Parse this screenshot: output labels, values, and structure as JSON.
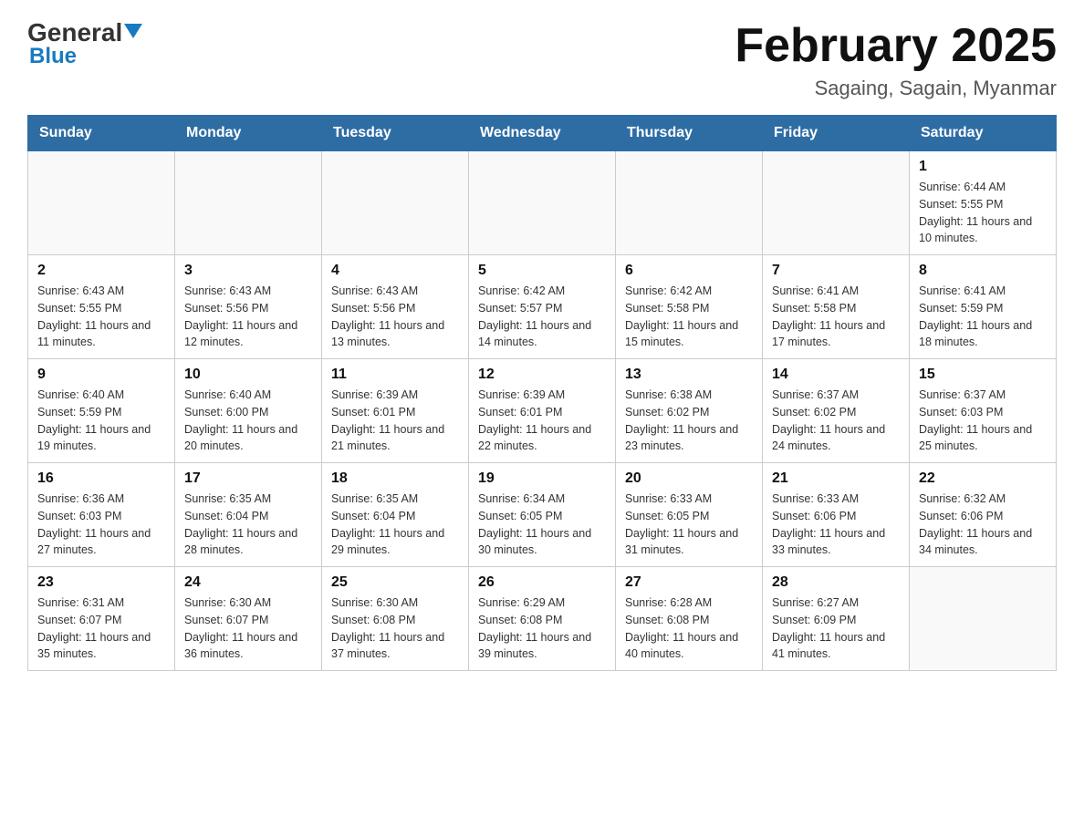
{
  "header": {
    "logo_general": "General",
    "logo_blue": "Blue",
    "month_title": "February 2025",
    "subtitle": "Sagaing, Sagain, Myanmar"
  },
  "days_of_week": [
    "Sunday",
    "Monday",
    "Tuesday",
    "Wednesday",
    "Thursday",
    "Friday",
    "Saturday"
  ],
  "weeks": [
    [
      null,
      null,
      null,
      null,
      null,
      null,
      {
        "day": "1",
        "sunrise": "Sunrise: 6:44 AM",
        "sunset": "Sunset: 5:55 PM",
        "daylight": "Daylight: 11 hours and 10 minutes."
      }
    ],
    [
      {
        "day": "2",
        "sunrise": "Sunrise: 6:43 AM",
        "sunset": "Sunset: 5:55 PM",
        "daylight": "Daylight: 11 hours and 11 minutes."
      },
      {
        "day": "3",
        "sunrise": "Sunrise: 6:43 AM",
        "sunset": "Sunset: 5:56 PM",
        "daylight": "Daylight: 11 hours and 12 minutes."
      },
      {
        "day": "4",
        "sunrise": "Sunrise: 6:43 AM",
        "sunset": "Sunset: 5:56 PM",
        "daylight": "Daylight: 11 hours and 13 minutes."
      },
      {
        "day": "5",
        "sunrise": "Sunrise: 6:42 AM",
        "sunset": "Sunset: 5:57 PM",
        "daylight": "Daylight: 11 hours and 14 minutes."
      },
      {
        "day": "6",
        "sunrise": "Sunrise: 6:42 AM",
        "sunset": "Sunset: 5:58 PM",
        "daylight": "Daylight: 11 hours and 15 minutes."
      },
      {
        "day": "7",
        "sunrise": "Sunrise: 6:41 AM",
        "sunset": "Sunset: 5:58 PM",
        "daylight": "Daylight: 11 hours and 17 minutes."
      },
      {
        "day": "8",
        "sunrise": "Sunrise: 6:41 AM",
        "sunset": "Sunset: 5:59 PM",
        "daylight": "Daylight: 11 hours and 18 minutes."
      }
    ],
    [
      {
        "day": "9",
        "sunrise": "Sunrise: 6:40 AM",
        "sunset": "Sunset: 5:59 PM",
        "daylight": "Daylight: 11 hours and 19 minutes."
      },
      {
        "day": "10",
        "sunrise": "Sunrise: 6:40 AM",
        "sunset": "Sunset: 6:00 PM",
        "daylight": "Daylight: 11 hours and 20 minutes."
      },
      {
        "day": "11",
        "sunrise": "Sunrise: 6:39 AM",
        "sunset": "Sunset: 6:01 PM",
        "daylight": "Daylight: 11 hours and 21 minutes."
      },
      {
        "day": "12",
        "sunrise": "Sunrise: 6:39 AM",
        "sunset": "Sunset: 6:01 PM",
        "daylight": "Daylight: 11 hours and 22 minutes."
      },
      {
        "day": "13",
        "sunrise": "Sunrise: 6:38 AM",
        "sunset": "Sunset: 6:02 PM",
        "daylight": "Daylight: 11 hours and 23 minutes."
      },
      {
        "day": "14",
        "sunrise": "Sunrise: 6:37 AM",
        "sunset": "Sunset: 6:02 PM",
        "daylight": "Daylight: 11 hours and 24 minutes."
      },
      {
        "day": "15",
        "sunrise": "Sunrise: 6:37 AM",
        "sunset": "Sunset: 6:03 PM",
        "daylight": "Daylight: 11 hours and 25 minutes."
      }
    ],
    [
      {
        "day": "16",
        "sunrise": "Sunrise: 6:36 AM",
        "sunset": "Sunset: 6:03 PM",
        "daylight": "Daylight: 11 hours and 27 minutes."
      },
      {
        "day": "17",
        "sunrise": "Sunrise: 6:35 AM",
        "sunset": "Sunset: 6:04 PM",
        "daylight": "Daylight: 11 hours and 28 minutes."
      },
      {
        "day": "18",
        "sunrise": "Sunrise: 6:35 AM",
        "sunset": "Sunset: 6:04 PM",
        "daylight": "Daylight: 11 hours and 29 minutes."
      },
      {
        "day": "19",
        "sunrise": "Sunrise: 6:34 AM",
        "sunset": "Sunset: 6:05 PM",
        "daylight": "Daylight: 11 hours and 30 minutes."
      },
      {
        "day": "20",
        "sunrise": "Sunrise: 6:33 AM",
        "sunset": "Sunset: 6:05 PM",
        "daylight": "Daylight: 11 hours and 31 minutes."
      },
      {
        "day": "21",
        "sunrise": "Sunrise: 6:33 AM",
        "sunset": "Sunset: 6:06 PM",
        "daylight": "Daylight: 11 hours and 33 minutes."
      },
      {
        "day": "22",
        "sunrise": "Sunrise: 6:32 AM",
        "sunset": "Sunset: 6:06 PM",
        "daylight": "Daylight: 11 hours and 34 minutes."
      }
    ],
    [
      {
        "day": "23",
        "sunrise": "Sunrise: 6:31 AM",
        "sunset": "Sunset: 6:07 PM",
        "daylight": "Daylight: 11 hours and 35 minutes."
      },
      {
        "day": "24",
        "sunrise": "Sunrise: 6:30 AM",
        "sunset": "Sunset: 6:07 PM",
        "daylight": "Daylight: 11 hours and 36 minutes."
      },
      {
        "day": "25",
        "sunrise": "Sunrise: 6:30 AM",
        "sunset": "Sunset: 6:08 PM",
        "daylight": "Daylight: 11 hours and 37 minutes."
      },
      {
        "day": "26",
        "sunrise": "Sunrise: 6:29 AM",
        "sunset": "Sunset: 6:08 PM",
        "daylight": "Daylight: 11 hours and 39 minutes."
      },
      {
        "day": "27",
        "sunrise": "Sunrise: 6:28 AM",
        "sunset": "Sunset: 6:08 PM",
        "daylight": "Daylight: 11 hours and 40 minutes."
      },
      {
        "day": "28",
        "sunrise": "Sunrise: 6:27 AM",
        "sunset": "Sunset: 6:09 PM",
        "daylight": "Daylight: 11 hours and 41 minutes."
      },
      null
    ]
  ]
}
